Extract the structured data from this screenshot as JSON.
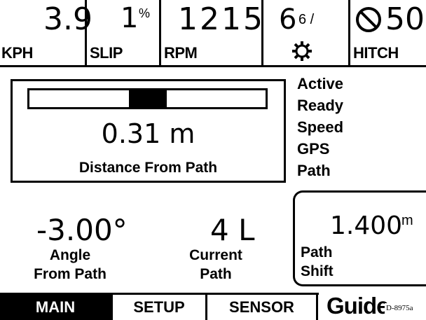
{
  "topbar": {
    "speed": {
      "value": "3.9",
      "unit": "KPH"
    },
    "slip": {
      "value": "1",
      "unit": "%",
      "label": "SLIP"
    },
    "rpm": {
      "value": "1215",
      "label": "RPM"
    },
    "gear": {
      "value": "6",
      "sub": "6 /",
      "icon": "gear-icon"
    },
    "hitch": {
      "value": "50",
      "label": "HITCH",
      "icon": "prohibited-icon"
    }
  },
  "distance": {
    "value": "0.31 m",
    "label": "Distance From Path",
    "lightbar_position": 0.5
  },
  "status_items": [
    "Active",
    "Ready",
    "Speed",
    "GPS",
    "Path"
  ],
  "angle": {
    "value": "-3.00°",
    "label_line1": "Angle",
    "label_line2": "From Path"
  },
  "current_path": {
    "value": "4 L",
    "label_line1": "Current",
    "label_line2": "Path"
  },
  "path_shift": {
    "value": "1.400",
    "unit": "m",
    "label_line1": "Path",
    "label_line2": "Shift"
  },
  "tabs": [
    {
      "label": "MAIN",
      "active": true
    },
    {
      "label": "SETUP",
      "active": false
    },
    {
      "label": "SENSOR",
      "active": false
    }
  ],
  "brand": "Guide",
  "doc_id": "D-8975a"
}
